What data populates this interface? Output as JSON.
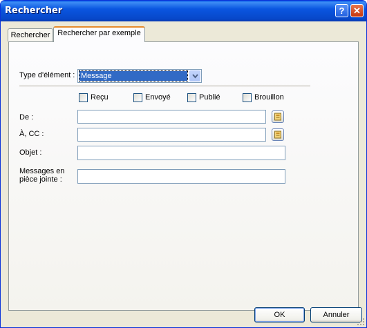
{
  "window": {
    "title": "Rechercher",
    "help_symbol": "?",
    "close_symbol": "✕"
  },
  "tabs": [
    {
      "label": "Rechercher",
      "active": false
    },
    {
      "label": "Rechercher par exemple",
      "active": true
    }
  ],
  "form": {
    "item_type_label": "Type d'élément :",
    "item_type_value": "Message",
    "checkboxes": [
      {
        "label": "Reçu",
        "checked": false
      },
      {
        "label": "Envoyé",
        "checked": false
      },
      {
        "label": "Publié",
        "checked": false
      },
      {
        "label": "Brouillon",
        "checked": false
      }
    ],
    "from_label": "De :",
    "from_value": "",
    "to_cc_label": "À, CC :",
    "to_cc_value": "",
    "subject_label": "Objet :",
    "subject_value": "",
    "attachments_label_line1": "Messages en",
    "attachments_label_line2": "pièce jointe :",
    "attachments_value": ""
  },
  "buttons": {
    "ok": "OK",
    "cancel": "Annuler"
  },
  "icons": {
    "address_book": "address-book-icon",
    "dropdown": "chevron-down-icon"
  },
  "colors": {
    "titlebar": "#0a56e0",
    "dialog_bg": "#ece9d8",
    "selection": "#316ac5",
    "active_tab_accent": "#e68b2c"
  }
}
